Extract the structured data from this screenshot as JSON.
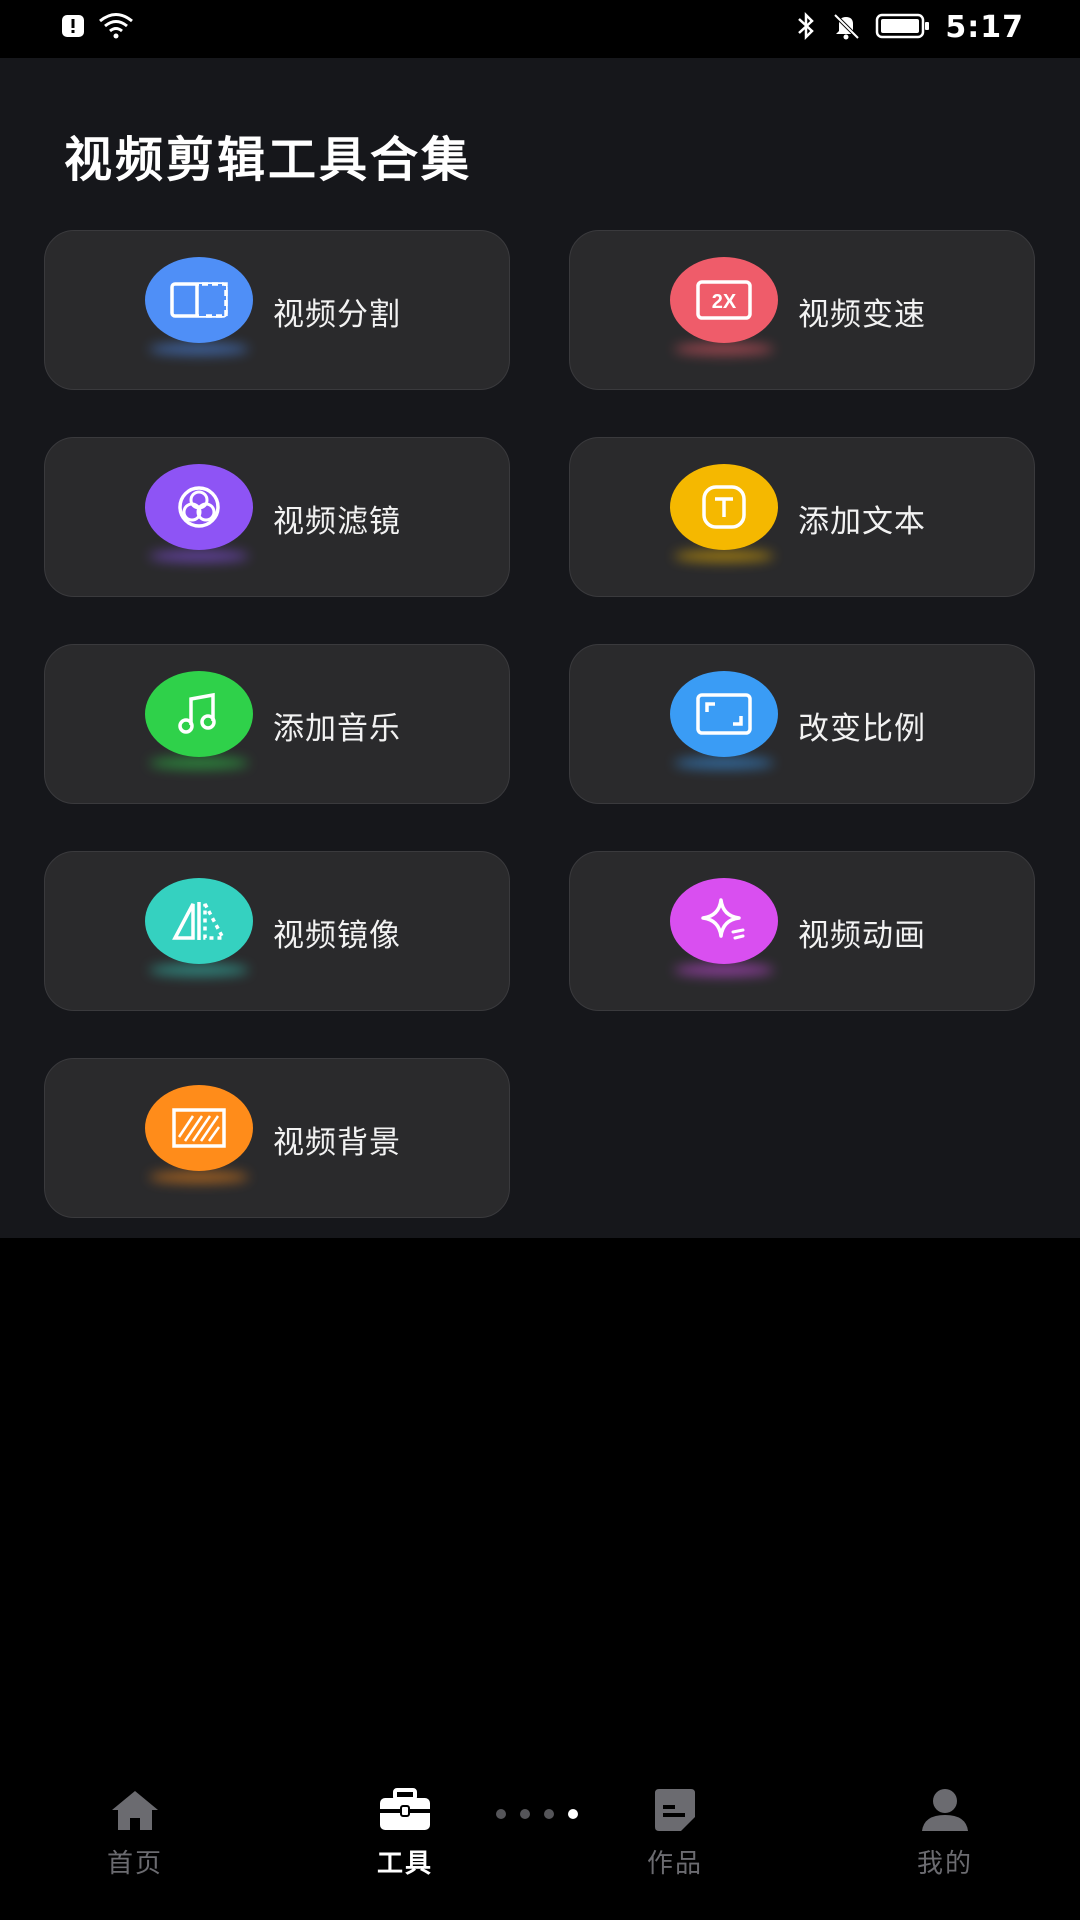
{
  "status_bar": {
    "time": "5:17",
    "icons": [
      "alert-icon",
      "wifi-icon",
      "bluetooth-icon",
      "mute-icon",
      "battery-icon"
    ]
  },
  "page": {
    "title": "视频剪辑工具合集"
  },
  "tools": [
    {
      "label": "视频分割",
      "icon": "split-icon",
      "color": "#4f8ff7"
    },
    {
      "label": "视频变速",
      "icon": "speed-2x-icon",
      "color": "#ef5c6a"
    },
    {
      "label": "视频滤镜",
      "icon": "filter-icon",
      "color": "#8e54f5"
    },
    {
      "label": "添加文本",
      "icon": "text-icon",
      "color": "#f5b800"
    },
    {
      "label": "添加音乐",
      "icon": "music-icon",
      "color": "#2fd14a"
    },
    {
      "label": "改变比例",
      "icon": "ratio-icon",
      "color": "#3a9cf5"
    },
    {
      "label": "视频镜像",
      "icon": "mirror-icon",
      "color": "#35d1c0"
    },
    {
      "label": "视频动画",
      "icon": "sparkle-icon",
      "color": "#d94ff0"
    },
    {
      "label": "视频背景",
      "icon": "background-icon",
      "color": "#ff8c1a"
    }
  ],
  "bottom_nav": {
    "items": [
      {
        "label": "首页",
        "icon": "home-icon",
        "active": false
      },
      {
        "label": "工具",
        "icon": "toolbox-icon",
        "active": true
      },
      {
        "label": "作品",
        "icon": "works-icon",
        "active": false
      },
      {
        "label": "我的",
        "icon": "profile-icon",
        "active": false
      }
    ],
    "pager_active_index": 3,
    "pager_count": 4
  }
}
